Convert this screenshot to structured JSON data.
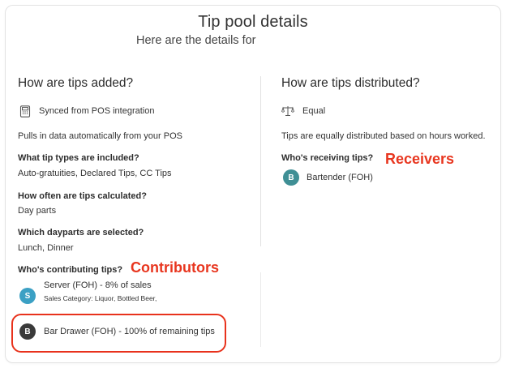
{
  "header": {
    "title": "Tip pool details",
    "subtitle": "Here are the details for"
  },
  "left": {
    "section_title": "How are tips added?",
    "source_icon": "pos-terminal-icon",
    "source": "Synced from POS integration",
    "source_desc": "Pulls in data automatically from your POS",
    "tip_types_q": "What tip types are included?",
    "tip_types_a": "Auto-gratuities, Declared Tips, CC Tips",
    "frequency_q": "How often are tips calculated?",
    "frequency_a": "Day parts",
    "dayparts_q": "Which dayparts are selected?",
    "dayparts_a": "Lunch, Dinner",
    "contributing_q": "Who's contributing tips?",
    "contributors": [
      {
        "initial": "S",
        "name": "Server (FOH) - 8% of sales",
        "detail": "Sales Category: Liquor, Bottled Beer,",
        "color": "#3ba0c4"
      },
      {
        "initial": "B",
        "name": "Bar Drawer (FOH) - 100% of remaining tips",
        "color": "#3a3a3a"
      }
    ]
  },
  "right": {
    "section_title": "How are tips distributed?",
    "method_icon": "balance-scale-icon",
    "method": "Equal",
    "method_desc": "Tips are equally distributed based on hours worked.",
    "receiving_q": "Who's receiving tips?",
    "receivers": [
      {
        "initial": "B",
        "name": "Bartender (FOH)",
        "color": "#3f8f95"
      }
    ]
  },
  "annotations": {
    "receivers": "Receivers",
    "contributors": "Contributors",
    "color": "#e8361f"
  }
}
